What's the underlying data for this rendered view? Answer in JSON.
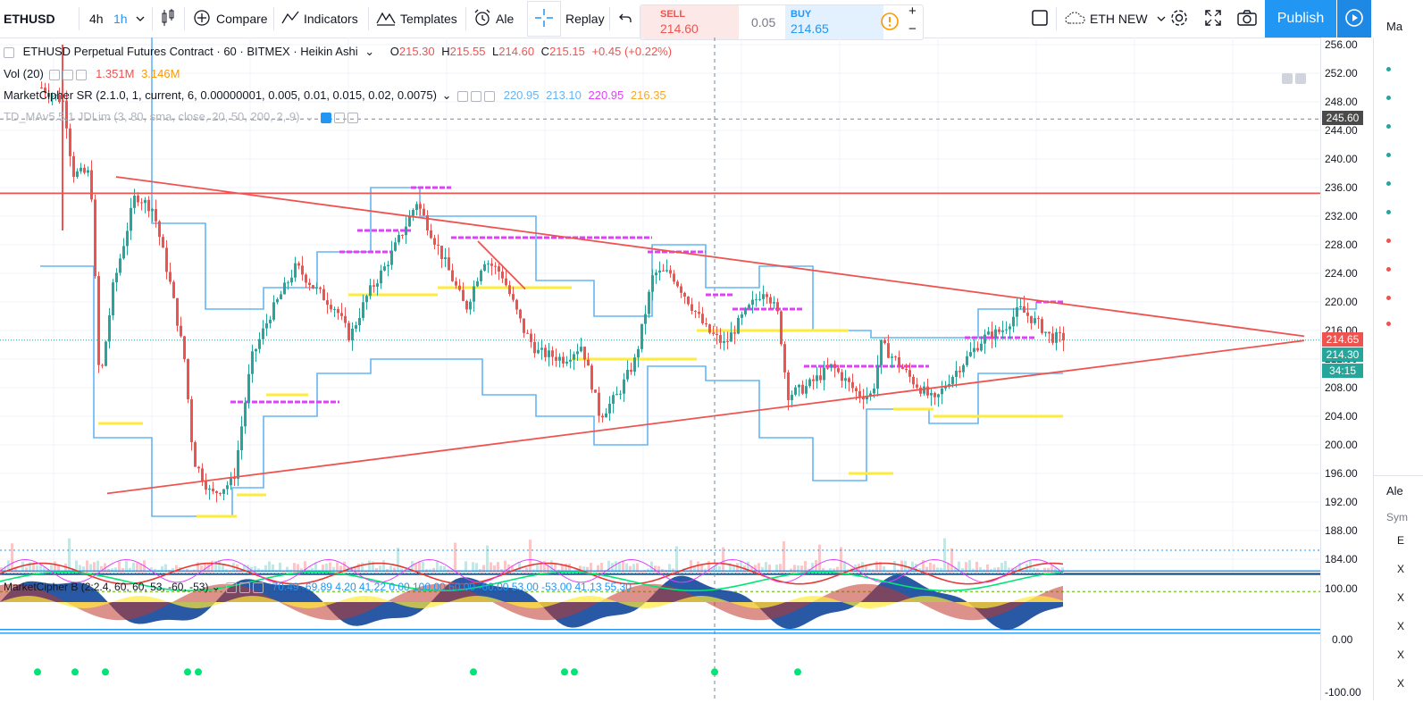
{
  "toolbar": {
    "symbol": "ETHUSD",
    "tf_4h": "4h",
    "tf_1h": "1h",
    "compare": "Compare",
    "indicators": "Indicators",
    "templates": "Templates",
    "alert": "Ale",
    "replay": "Replay",
    "layout_name": "ETH NEW",
    "publish": "Publish"
  },
  "trade": {
    "sell_label": "SELL",
    "sell_price": "214.60",
    "spread": "0.05",
    "buy_label": "BUY",
    "buy_price": "214.65",
    "plus": "+",
    "minus": "−"
  },
  "legend": {
    "title": "ETHUSD Perpetual Futures Contract · 60 · BITMEX · Heikin Ashi",
    "o_label": "O",
    "o_val": "215.30",
    "h_label": "H",
    "h_val": "215.55",
    "l_label": "L",
    "l_val": "214.60",
    "c_label": "C",
    "c_val": "215.15",
    "change": "+0.45 (+0.22%)",
    "vol_name": "Vol (20)",
    "vol_v1": "1.351M",
    "vol_v2": "3.146M",
    "mc_sr": "MarketCipher SR (2.1.0, 1, current, 6, 0.00000001, 0.005, 0.01, 0.015, 0.02, 0.0075)",
    "mc_v1": "220.95",
    "mc_v2": "213.10",
    "mc_v3": "220.95",
    "mc_v4": "216.35",
    "td_ma": "TD_MAv5.5.1 JDLim (3, 80, sma, close, 20, 50, 200, 2, 9)",
    "mcb": "MarketCipher B (2:2.4, 60, 60, 53, -60, -53)",
    "mcb_vals": "70.49  -69.89  4.20  41.22  0.00  100.00  60.00  -60.00  53.00  -53.00  41.13  55.30"
  },
  "price_axis": {
    "ticks": [
      "256.00",
      "252.00",
      "248.00",
      "244.00",
      "240.00",
      "236.00",
      "232.00",
      "228.00",
      "224.00",
      "220.00",
      "216.00",
      "212.00",
      "208.00",
      "204.00",
      "200.00",
      "196.00",
      "192.00",
      "188.00",
      "184.00"
    ],
    "crosshair_price": "245.60",
    "last_price": "214.65",
    "prev_price": "214.30",
    "countdown": "34:15",
    "osc_ticks": [
      "100.00",
      "0.00",
      "-100.00"
    ]
  },
  "right_panel": {
    "header": "Ma",
    "alerts_header": "Ale",
    "sym_label": "Sym",
    "letters": [
      "E",
      "X",
      "X",
      "X",
      "X",
      "X"
    ]
  },
  "colors": {
    "up": "#26a69a",
    "down": "#ef5350",
    "accent": "#2196f3",
    "sr_blue": "#64b5f6",
    "magenta": "#e040fb",
    "yellow": "#ffeb3b"
  }
}
